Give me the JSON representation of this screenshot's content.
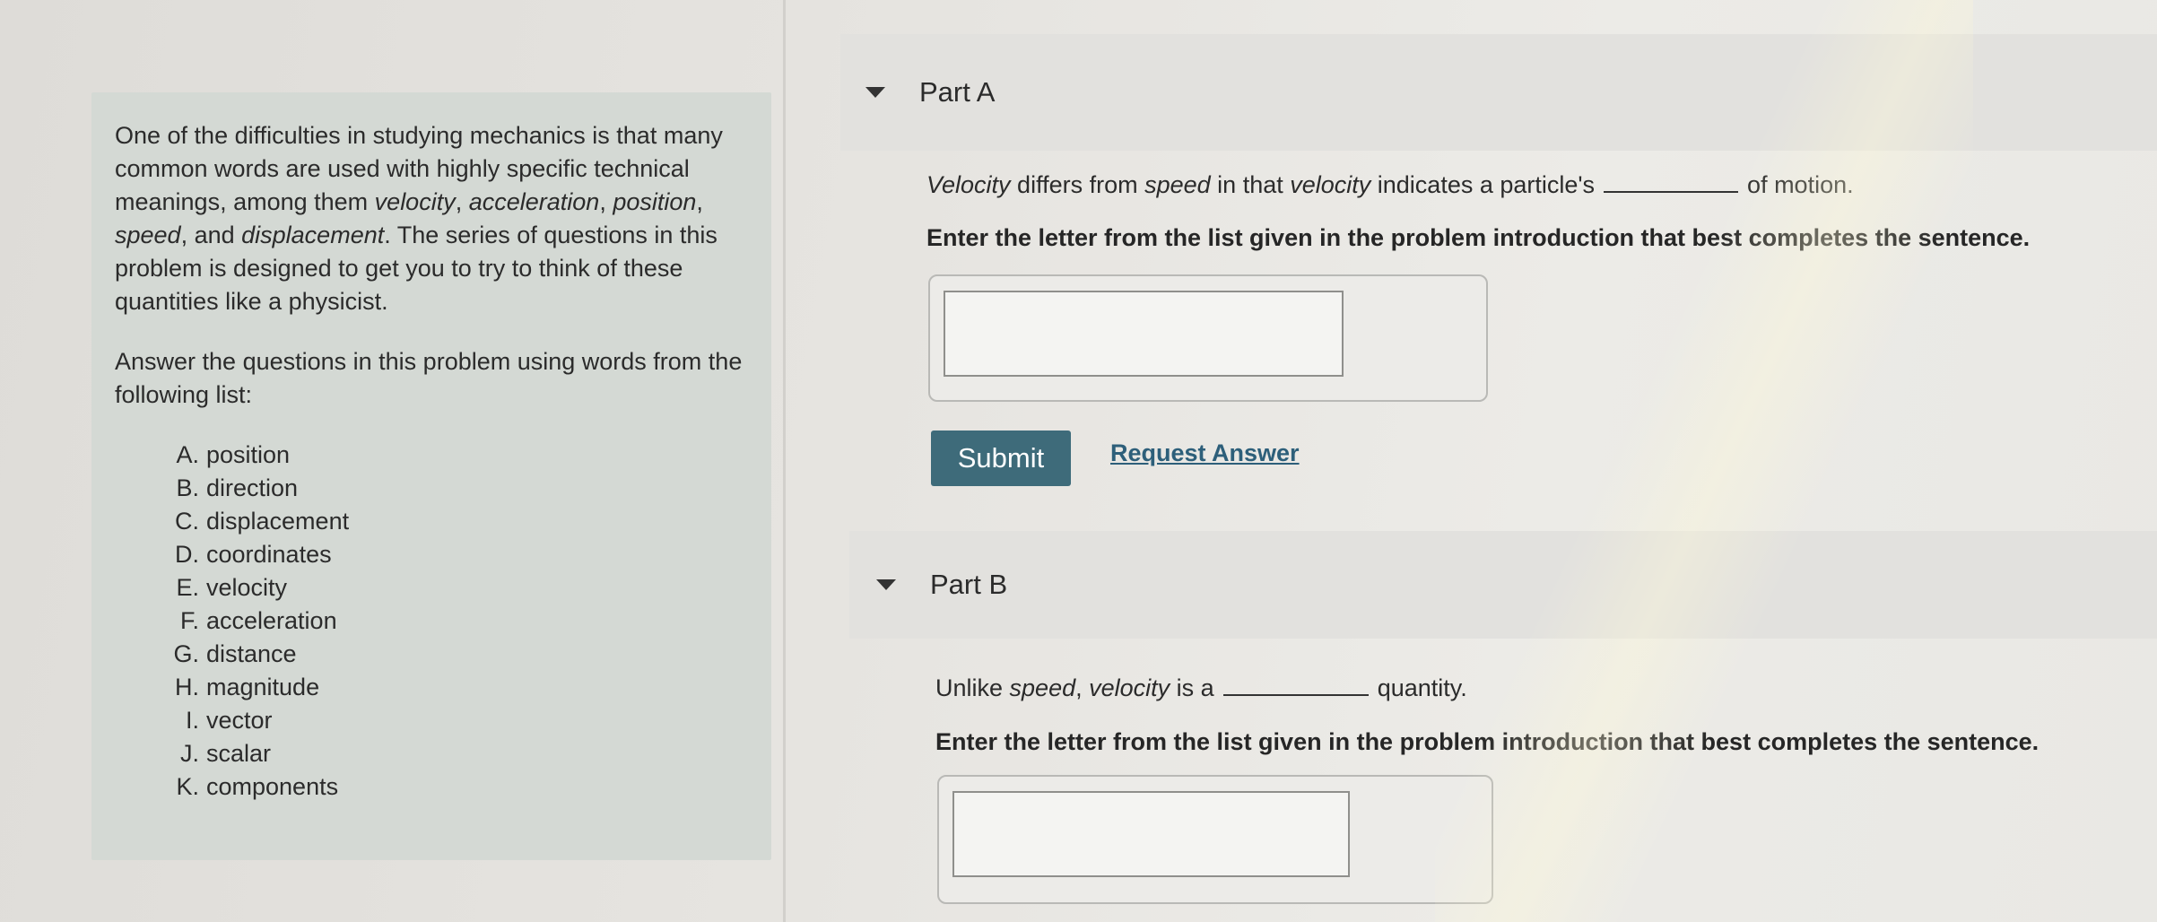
{
  "intro": {
    "p1_a": "One of the difficulties in studying mechanics is that many common words are used with highly specific technical meanings, among them ",
    "t_velocity": "velocity",
    "sep1": ", ",
    "t_acceleration": "acceleration",
    "sep2": ", ",
    "t_position": "position",
    "sep3": ", ",
    "t_speed": "speed",
    "sep4": ", and ",
    "t_displacement": "displacement",
    "p1_b": ". The series of questions in this problem is designed to get you to try to think of these quantities like a physicist.",
    "p2": "Answer the questions in this problem using words from the following list:",
    "items": [
      {
        "letter": "A.",
        "word": "position"
      },
      {
        "letter": "B.",
        "word": "direction"
      },
      {
        "letter": "C.",
        "word": "displacement"
      },
      {
        "letter": "D.",
        "word": "coordinates"
      },
      {
        "letter": "E.",
        "word": "velocity"
      },
      {
        "letter": "F.",
        "word": "acceleration"
      },
      {
        "letter": "G.",
        "word": "distance"
      },
      {
        "letter": "H.",
        "word": "magnitude"
      },
      {
        "letter": "I.",
        "word": "vector"
      },
      {
        "letter": "J.",
        "word": "scalar"
      },
      {
        "letter": "K.",
        "word": "components"
      }
    ]
  },
  "partA": {
    "title": "Part A",
    "q_velocity": "Velocity",
    "q_mid1": " differs from ",
    "q_speed": "speed",
    "q_mid2": " in that ",
    "q_velocity2": "velocity",
    "q_mid3": " indicates a particle's",
    "q_end": "of motion.",
    "instruction": "Enter the letter from the list given in the problem introduction that best completes the sentence.",
    "input_value": ""
  },
  "actions": {
    "submit": "Submit",
    "request": "Request Answer"
  },
  "partB": {
    "title": "Part B",
    "q_start": "Unlike ",
    "q_speed": "speed",
    "q_mid1": ", ",
    "q_velocity": "velocity",
    "q_mid2": " is a",
    "q_end": "quantity.",
    "instruction": "Enter the letter from the list given in the problem introduction that best completes the sentence.",
    "input_value": ""
  }
}
